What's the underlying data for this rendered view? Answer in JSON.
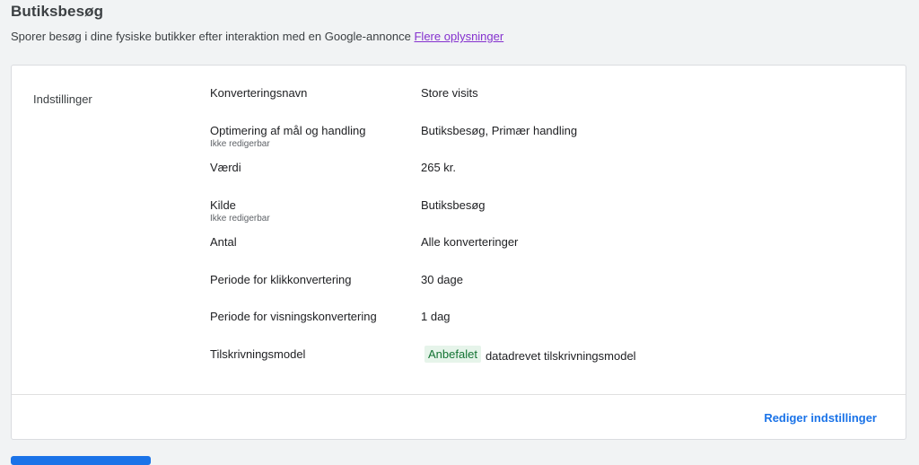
{
  "header": {
    "title": "Butiksbesøg",
    "subtitle": "Sporer besøg i dine fysiske butikker efter interaktion med en Google-annonce",
    "more_info_link": "Flere oplysninger"
  },
  "settings": {
    "section_label": "Indstillinger",
    "rows": [
      {
        "label": "Konverteringsnavn",
        "sublabel": "",
        "value": "Store visits"
      },
      {
        "label": "Optimering af mål og handling",
        "sublabel": "Ikke redigerbar",
        "value": "Butiksbesøg, Primær handling"
      },
      {
        "label": "Værdi",
        "sublabel": "",
        "value": "265 kr."
      },
      {
        "label": "Kilde",
        "sublabel": "Ikke redigerbar",
        "value": "Butiksbesøg"
      },
      {
        "label": "Antal",
        "sublabel": "",
        "value": "Alle konverteringer"
      },
      {
        "label": "Periode for klikkonvertering",
        "sublabel": "",
        "value": "30 dage"
      },
      {
        "label": "Periode for visningskonvertering",
        "sublabel": "",
        "value": "1 dag"
      },
      {
        "label": "Tilskrivningsmodel",
        "sublabel": "",
        "badge": "Anbefalet",
        "value": "datadrevet tilskrivningsmodel"
      }
    ],
    "edit_button": "Rediger indstillinger"
  },
  "colors": {
    "link": "#8430ce",
    "action": "#1a73e8",
    "badge_bg": "#e6f4ea",
    "badge_text": "#137333"
  }
}
